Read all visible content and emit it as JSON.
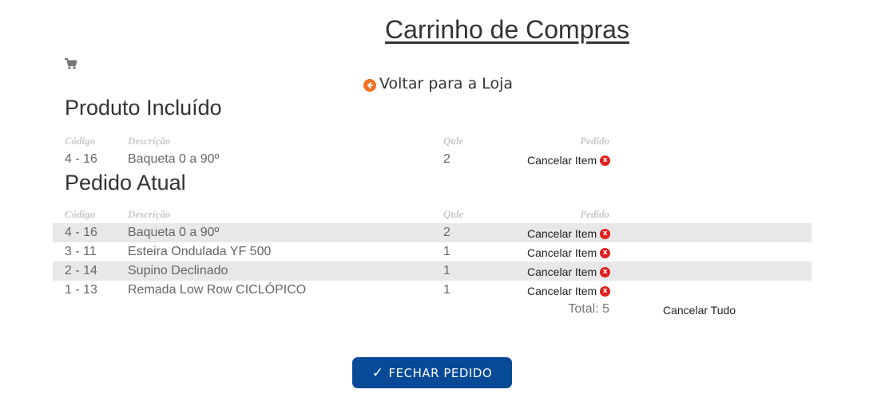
{
  "page": {
    "title": "Carrinho de Compras",
    "back_link": "Voltar para a Loja"
  },
  "included": {
    "title": "Produto Incluído",
    "headers": {
      "code": "Código",
      "description": "Descrição",
      "qty": "Qtde",
      "order": "Pedido"
    },
    "rows": [
      {
        "code": "4 - 16",
        "description": "Baqueta 0 a 90º",
        "qty": "2",
        "cancel": "Cancelar Item"
      }
    ]
  },
  "current": {
    "title": "Pedido Atual",
    "headers": {
      "code": "Código",
      "description": "Descrição",
      "qty": "Qtde",
      "order": "Pedido"
    },
    "rows": [
      {
        "code": "4 - 16",
        "description": "Baqueta 0 a 90º",
        "qty": "2",
        "cancel": "Cancelar Item"
      },
      {
        "code": "3 - 11",
        "description": "Esteira Ondulada YF 500",
        "qty": "1",
        "cancel": "Cancelar Item"
      },
      {
        "code": "2 - 14",
        "description": "Supino Declinado",
        "qty": "1",
        "cancel": "Cancelar Item"
      },
      {
        "code": "1 - 13",
        "description": "Remada Low Row CICLÓPICO",
        "qty": "1",
        "cancel": "Cancelar Item"
      }
    ],
    "total": "Total: 5",
    "cancel_all": "Cancelar Tudo"
  },
  "actions": {
    "close_order": "FECHAR PEDIDO"
  },
  "colors": {
    "accent_orange": "#f36f21",
    "button_blue": "#064a98",
    "cancel_red": "#e0201f",
    "stripe": "#e8e8e8"
  },
  "icons": {
    "cart": "cart-icon",
    "back": "arrow-left-circle-icon",
    "cancel": "x-circle-icon",
    "check": "checkmark-icon"
  }
}
